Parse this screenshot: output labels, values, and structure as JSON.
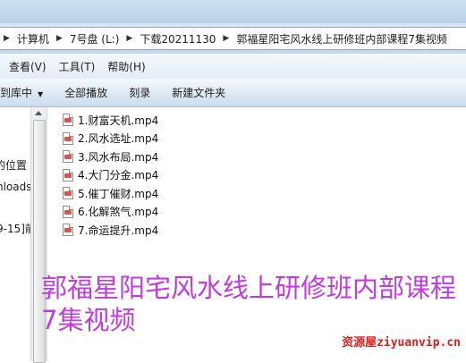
{
  "address_bar": {
    "crumbs": [
      "计算机",
      "7号盘 (L:)",
      "下载20211130",
      "郭福星阳宅风水线上研修班内部课程7集视频"
    ]
  },
  "menu": {
    "items": [
      "查看(V)",
      "工具(T)",
      "帮助(H)"
    ]
  },
  "toolbar": {
    "include_label": "到库中",
    "play_all_label": "全部播放",
    "burn_label": "刻录",
    "new_folder_label": "新建文件夹"
  },
  "nav_pane": {
    "items": [
      "的位置",
      "nloads",
      "9-15]前"
    ]
  },
  "files": [
    {
      "name": "1.财富天机.mp4"
    },
    {
      "name": "2.风水选址.mp4"
    },
    {
      "name": "3.风水布局.mp4"
    },
    {
      "name": "4.大门分金.mp4"
    },
    {
      "name": "5.催丁催财.mp4"
    },
    {
      "name": "6.化解煞气.mp4"
    },
    {
      "name": "7.命运提升.mp4"
    }
  ],
  "overlay": {
    "line1": "郭福星阳宅风水线上研修班内部课程",
    "line2": "7集视频"
  },
  "watermark": "资源屋ziyuanvip.cn",
  "colors": {
    "overlay_text": "#c03ce0",
    "watermark": "#e0201c",
    "file_icon": "#d9534f"
  }
}
